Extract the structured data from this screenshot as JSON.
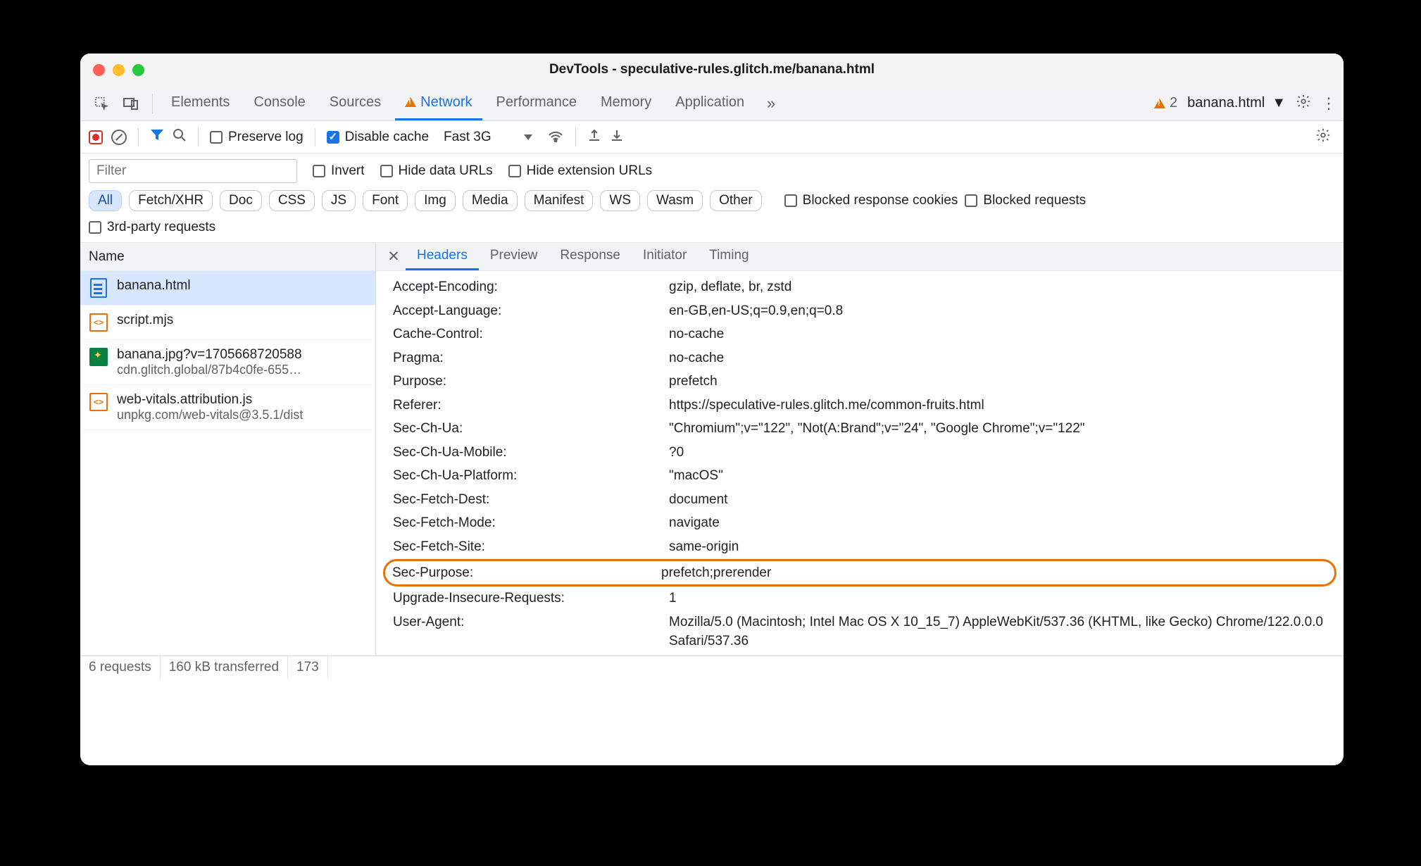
{
  "window_title": "DevTools - speculative-rules.glitch.me/banana.html",
  "tabs": [
    "Elements",
    "Console",
    "Sources",
    "Network",
    "Performance",
    "Memory",
    "Application"
  ],
  "active_tab": "Network",
  "warning_count": "2",
  "target_name": "banana.html",
  "toolbar": {
    "preserve_log": "Preserve log",
    "disable_cache": "Disable cache",
    "throttle": "Fast 3G"
  },
  "filter": {
    "placeholder": "Filter",
    "invert": "Invert",
    "hide_data": "Hide data URLs",
    "hide_ext": "Hide extension URLs",
    "types": [
      "All",
      "Fetch/XHR",
      "Doc",
      "CSS",
      "JS",
      "Font",
      "Img",
      "Media",
      "Manifest",
      "WS",
      "Wasm",
      "Other"
    ],
    "blocked_cookies": "Blocked response cookies",
    "blocked_req": "Blocked requests",
    "third_party": "3rd-party requests"
  },
  "left_header": "Name",
  "requests": [
    {
      "name": "banana.html",
      "sub": "",
      "icon": "doc",
      "selected": true
    },
    {
      "name": "script.mjs",
      "sub": "",
      "icon": "js"
    },
    {
      "name": "banana.jpg?v=1705668720588",
      "sub": "cdn.glitch.global/87b4c0fe-655…",
      "icon": "img"
    },
    {
      "name": "web-vitals.attribution.js",
      "sub": "unpkg.com/web-vitals@3.5.1/dist",
      "icon": "js"
    }
  ],
  "right_tabs": [
    "Headers",
    "Preview",
    "Response",
    "Initiator",
    "Timing"
  ],
  "headers": [
    {
      "name": "Accept-Encoding:",
      "value": "gzip, deflate, br, zstd"
    },
    {
      "name": "Accept-Language:",
      "value": "en-GB,en-US;q=0.9,en;q=0.8"
    },
    {
      "name": "Cache-Control:",
      "value": "no-cache"
    },
    {
      "name": "Pragma:",
      "value": "no-cache"
    },
    {
      "name": "Purpose:",
      "value": "prefetch"
    },
    {
      "name": "Referer:",
      "value": "https://speculative-rules.glitch.me/common-fruits.html"
    },
    {
      "name": "Sec-Ch-Ua:",
      "value": "\"Chromium\";v=\"122\", \"Not(A:Brand\";v=\"24\", \"Google Chrome\";v=\"122\""
    },
    {
      "name": "Sec-Ch-Ua-Mobile:",
      "value": "?0"
    },
    {
      "name": "Sec-Ch-Ua-Platform:",
      "value": "\"macOS\""
    },
    {
      "name": "Sec-Fetch-Dest:",
      "value": "document"
    },
    {
      "name": "Sec-Fetch-Mode:",
      "value": "navigate"
    },
    {
      "name": "Sec-Fetch-Site:",
      "value": "same-origin"
    },
    {
      "name": "Sec-Purpose:",
      "value": "prefetch;prerender",
      "highlight": true
    },
    {
      "name": "Upgrade-Insecure-Requests:",
      "value": "1"
    },
    {
      "name": "User-Agent:",
      "value": "Mozilla/5.0 (Macintosh; Intel Mac OS X 10_15_7) AppleWebKit/537.36 (KHTML, like Gecko) Chrome/122.0.0.0 Safari/537.36"
    }
  ],
  "status": {
    "requests": "6 requests",
    "transferred": "160 kB transferred",
    "resources": "173"
  }
}
